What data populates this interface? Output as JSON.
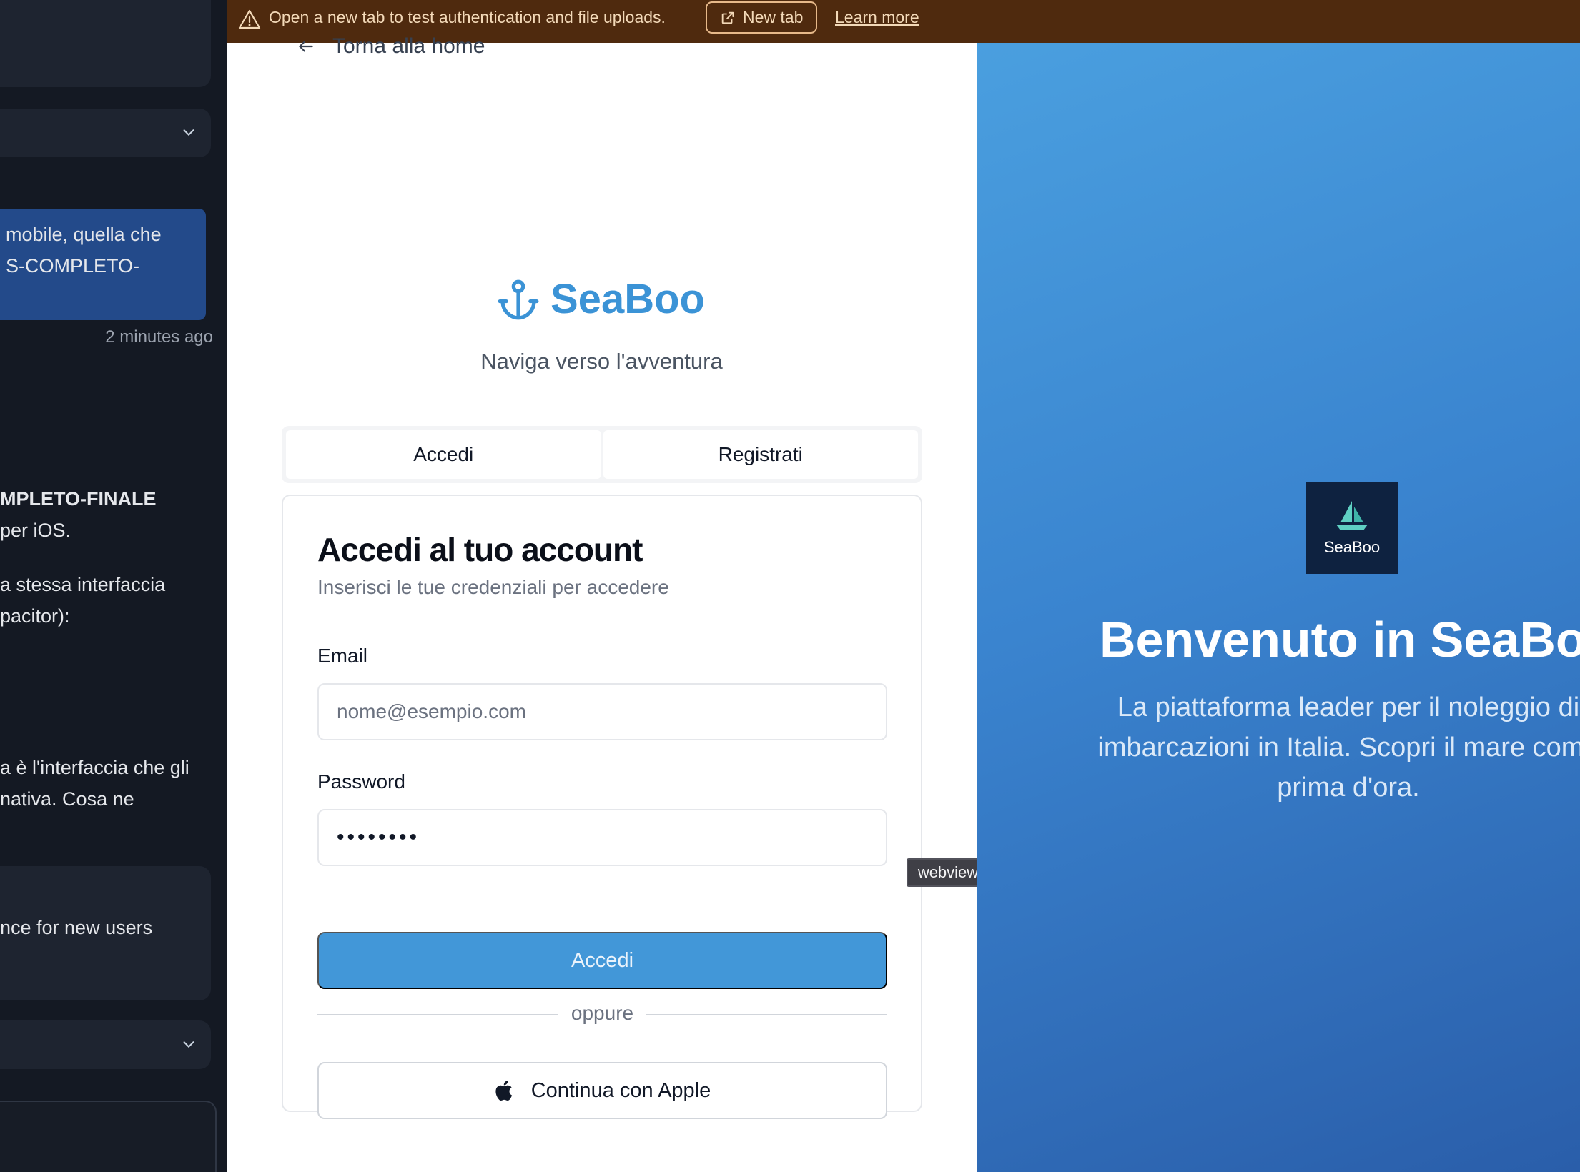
{
  "sidebar": {
    "bubble_lines": [
      "mobile, quella che",
      "S-COMPLETO-"
    ],
    "timestamp": "2 minutes ago",
    "text_lines": [
      "MPLETO-FINALE",
      "per iOS.",
      "a stessa interfaccia",
      "pacitor):",
      "a è l'interfaccia che gli",
      "nativa. Cosa ne"
    ],
    "card_text": "nce for new users"
  },
  "banner": {
    "message": "Open a new tab to test authentication and file uploads.",
    "new_tab_label": "New tab",
    "learn_more_label": "Learn more"
  },
  "login": {
    "back_label": "Torna alla home",
    "brand": "SeaBoo",
    "tagline": "Naviga verso l'avventura",
    "tabs": [
      {
        "label": "Accedi",
        "active": true
      },
      {
        "label": "Registrati",
        "active": false
      }
    ],
    "card_title": "Accedi al tuo account",
    "card_subtitle": "Inserisci le tue credenziali per accedere",
    "email_label": "Email",
    "email_placeholder": "nome@esempio.com",
    "password_label": "Password",
    "password_value": "••••••••",
    "submit_label": "Accedi",
    "divider_label": "oppure",
    "apple_label": "Continua con Apple",
    "tooltip": "webview"
  },
  "hero": {
    "logo_text": "SeaBoo",
    "title": "Benvenuto in SeaBoo",
    "description_lines": [
      "La piattaforma leader per il noleggio di",
      "imbarcazioni in Italia. Scopri il mare come",
      "prima d'ora."
    ]
  },
  "colors": {
    "banner_bg": "#4f2a0e",
    "brand_blue": "#3b93d6",
    "button_blue": "#4297d8",
    "hero_dark": "#0e2240"
  }
}
